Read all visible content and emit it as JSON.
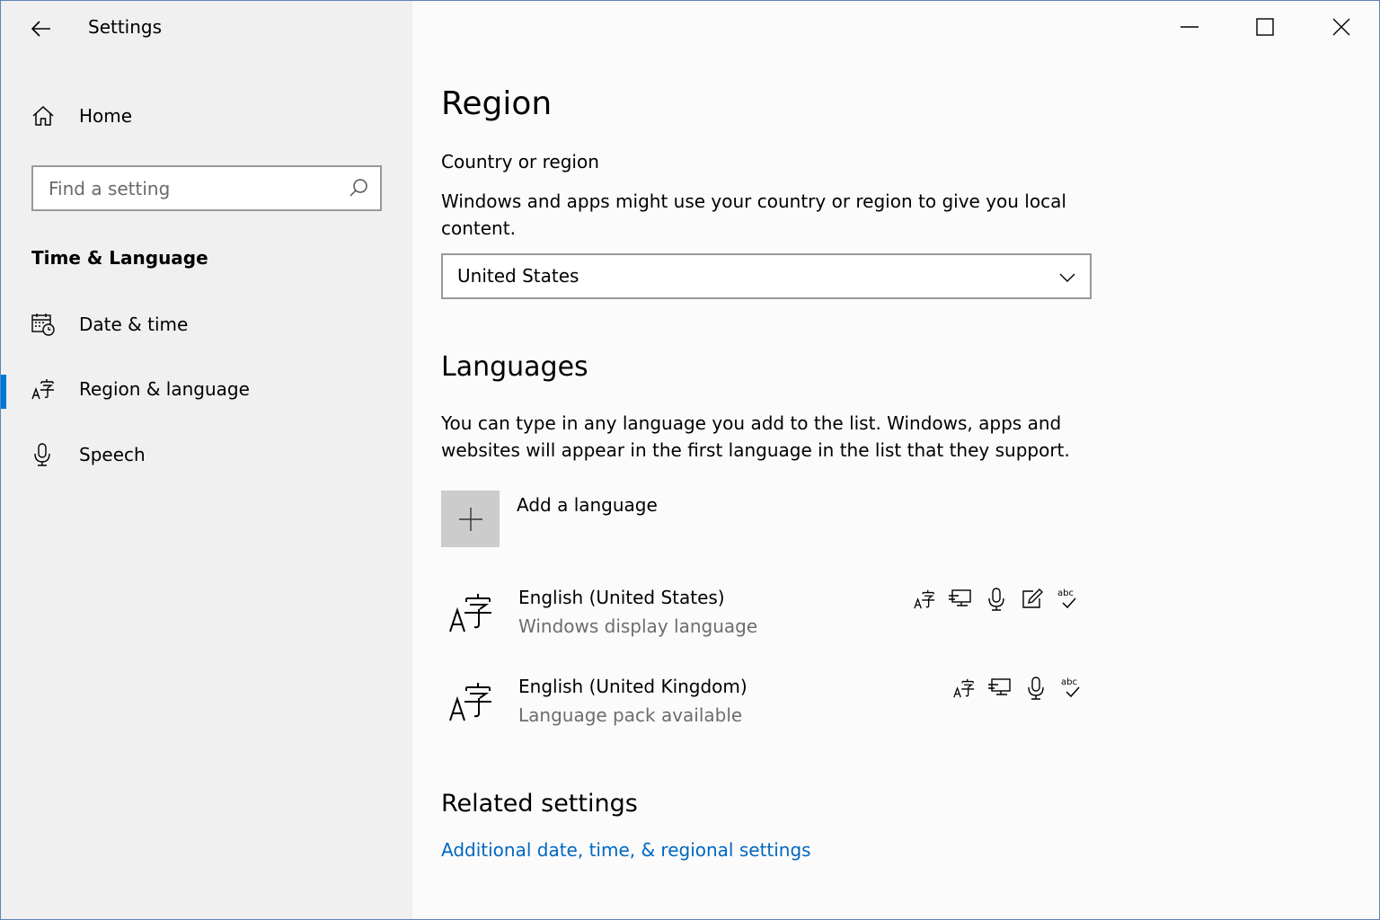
{
  "window": {
    "title": "Settings",
    "controls": [
      "minimize",
      "maximize",
      "close"
    ]
  },
  "sidebar": {
    "home_label": "Home",
    "search_placeholder": "Find a setting",
    "group_title": "Time & Language",
    "items": [
      {
        "label": "Date & time",
        "icon": "calendar-clock-icon",
        "selected": false
      },
      {
        "label": "Region & language",
        "icon": "language-icon",
        "selected": true
      },
      {
        "label": "Speech",
        "icon": "microphone-icon",
        "selected": false
      }
    ]
  },
  "main": {
    "title": "Region",
    "country": {
      "label": "Country or region",
      "description": "Windows and apps might use your country or region to give you local content.",
      "selected": "United States"
    },
    "languages": {
      "title": "Languages",
      "description": "You can type in any language you add to the list. Windows, apps and websites will appear in the first language in the list that they support.",
      "add_label": "Add a language",
      "list": [
        {
          "name": "English (United States)",
          "status": "Windows display language",
          "features": [
            "display-language-icon",
            "text-to-speech-icon",
            "speech-recognition-icon",
            "handwriting-icon",
            "spell-check-icon"
          ]
        },
        {
          "name": "English (United Kingdom)",
          "status": "Language pack available",
          "features": [
            "display-language-icon",
            "text-to-speech-icon",
            "speech-recognition-icon",
            "spell-check-icon"
          ]
        }
      ]
    },
    "related": {
      "title": "Related settings",
      "link": "Additional date, time, & regional settings"
    }
  },
  "colors": {
    "accent": "#0078d7",
    "link": "#0067c0",
    "sidebar_bg": "#f0f0f0",
    "secondary_text": "#6d6d6d"
  }
}
